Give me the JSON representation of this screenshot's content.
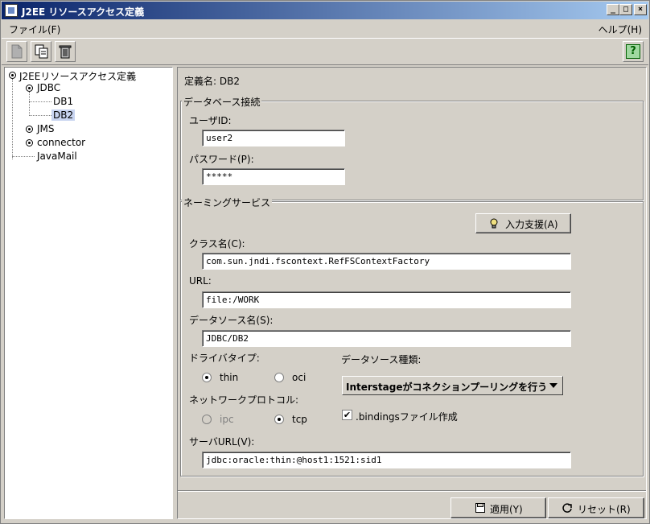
{
  "window": {
    "title": "J2EE リソースアクセス定義",
    "controls": {
      "minimize": "_",
      "maximize": "□",
      "close": "×"
    }
  },
  "menu": {
    "file": "ファイル(F)",
    "help": "ヘルプ(H)"
  },
  "toolbar": {
    "icons": [
      "new-document-icon",
      "copy-icon",
      "trash-icon"
    ],
    "help_icon_glyph": "?"
  },
  "tree": {
    "root": "J2EEリソースアクセス定義",
    "jdbc": "JDBC",
    "db1": "DB1",
    "db2": "DB2",
    "jms": "JMS",
    "connector": "connector",
    "javamail": "JavaMail"
  },
  "detail": {
    "definition_label": "定義名: DB2",
    "db_group": {
      "legend": "データベース接続",
      "user_label": "ユーザID:",
      "user_value": "user2",
      "password_label": "パスワード(P):",
      "password_value": "*****"
    },
    "naming_group": {
      "legend": "ネーミングサービス",
      "assist_button": "入力支援(A)",
      "class_label": "クラス名(C):",
      "class_value": "com.sun.jndi.fscontext.RefFSContextFactory",
      "url_label": "URL:",
      "url_value": "file:/WORK",
      "datasource_label": "データソース名(S):",
      "datasource_value": "JDBC/DB2",
      "driver_type_label": "ドライバタイプ:",
      "driver_thin": "thin",
      "driver_oci": "oci",
      "driver_selected": "thin",
      "protocol_label": "ネットワークプロトコル:",
      "protocol_ipc": "ipc",
      "protocol_tcp": "tcp",
      "protocol_selected": "tcp",
      "ds_kind_label": "データソース種類:",
      "ds_kind_value": "Interstageがコネクションプーリングを行う",
      "bindings_label": ".bindingsファイル作成",
      "bindings_checked": true,
      "server_url_label": "サーバURL(V):",
      "server_url_value": "jdbc:oracle:thin:@host1:1521:sid1"
    },
    "apply_button": "適用(Y)",
    "reset_button": "リセット(R)"
  },
  "colors": {
    "titlebar_start": "#0a246a",
    "titlebar_end": "#a6caf0",
    "window_bg": "#d4d0c8",
    "selection": "#c8d4f0"
  }
}
